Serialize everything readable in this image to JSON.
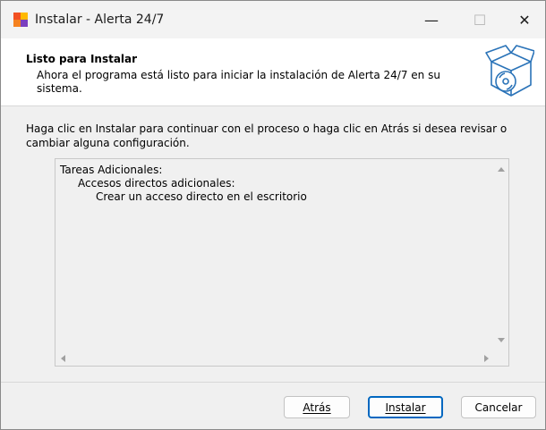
{
  "window": {
    "title": "Instalar - Alerta 24/7",
    "minimize_glyph": "—",
    "maximize_glyph": "☐",
    "close_glyph": "✕"
  },
  "header": {
    "title": "Listo para Instalar",
    "subtitle": "Ahora el programa está listo para iniciar la instalación de Alerta 24/7 en su sistema.",
    "icon": "setup-box-cd-icon"
  },
  "body": {
    "description": "Haga clic en Instalar para continuar con el proceso o haga clic en Atrás si desea revisar o cambiar alguna configuración.",
    "memo": {
      "lines": [
        "Tareas Adicionales:",
        "Accesos directos adicionales:",
        "Crear un acceso directo en el escritorio"
      ]
    }
  },
  "buttons": {
    "back": "Atrás",
    "install": "Instalar",
    "cancel": "Cancelar"
  },
  "colors": {
    "default_button_border": "#0067c0"
  }
}
